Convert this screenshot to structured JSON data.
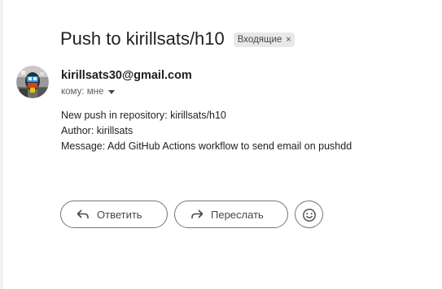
{
  "email": {
    "subject": "Push to kirillsats/h10",
    "label": "Входящие",
    "label_remove_icon": "×",
    "sender": "kirillsats30@gmail.com",
    "recipient_text": "кому: мне",
    "body_lines": [
      "New push in repository: kirillsats/h10",
      "Author: kirillsats",
      "Message: Add GitHub Actions workflow to send email on pushdd"
    ]
  },
  "actions": {
    "reply_label": "Ответить",
    "forward_label": "Переслать",
    "emoji_icon": "smiley-icon"
  },
  "colors": {
    "chip_bg": "#e8e8e8",
    "button_border": "#747775",
    "text": "#1f1f1f"
  }
}
